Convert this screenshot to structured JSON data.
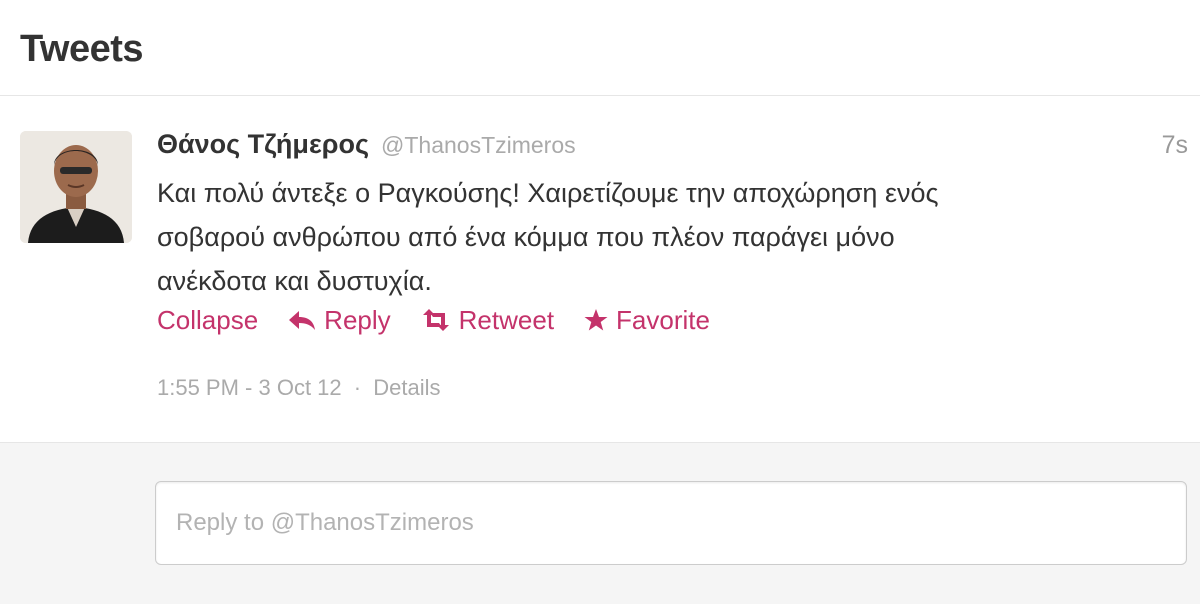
{
  "header": {
    "title": "Tweets"
  },
  "tweet": {
    "fullname": "Θάνος Τζήμερος",
    "username": "@ThanosTzimeros",
    "time_ago": "7s",
    "text_lines": [
      "Και πολύ άντεξε ο Ραγκούσης! Χαιρετίζουμε την αποχώρηση ενός",
      "σοβαρού ανθρώπου από ένα κόμμα που πλέον παράγει μόνο",
      "ανέκδοτα και δυστυχία."
    ],
    "actions": {
      "collapse": "Collapse",
      "reply": "Reply",
      "retweet": "Retweet",
      "favorite": "Favorite"
    },
    "meta": {
      "datetime": "1:55 PM - 3 Oct 12",
      "separator": "·",
      "details": "Details"
    }
  },
  "reply": {
    "placeholder": "Reply to @ThanosTzimeros"
  },
  "colors": {
    "action": "#c4336b",
    "muted": "#aaaaaa",
    "text": "#333333"
  },
  "icons": {
    "reply": "reply-arrow-icon",
    "retweet": "retweet-icon",
    "favorite": "star-icon"
  }
}
